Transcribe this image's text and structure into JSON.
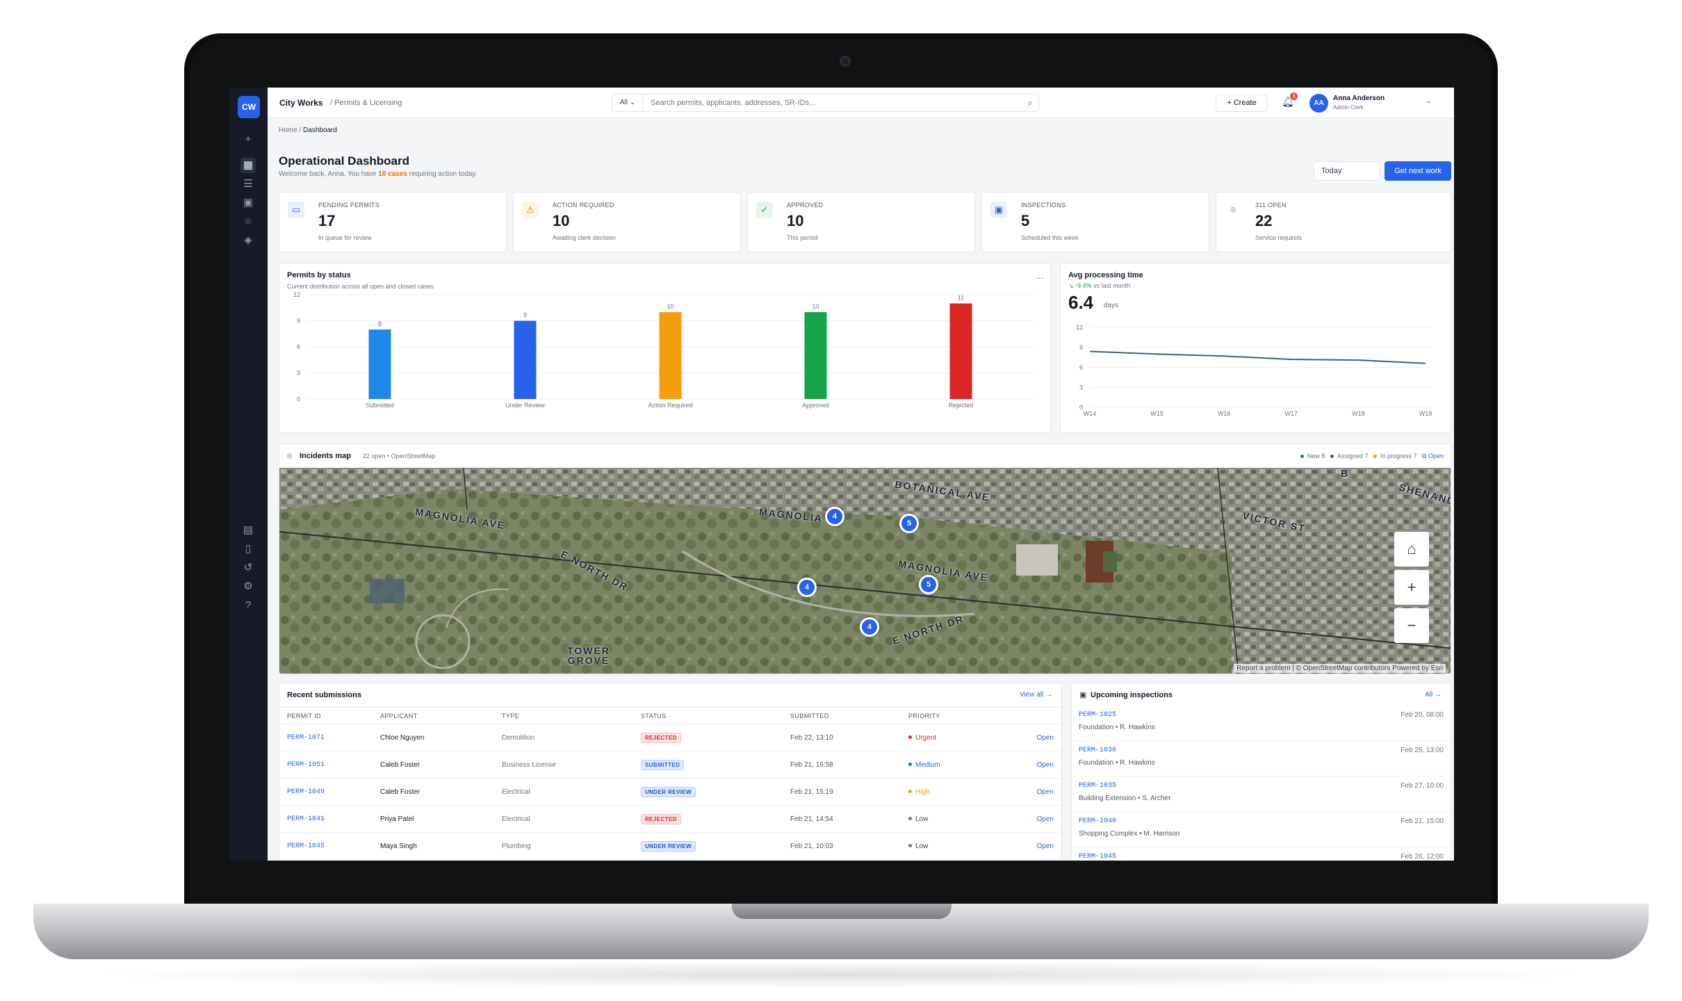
{
  "app": {
    "logo": "CW",
    "name": "City Works",
    "section": "/ Permits & Licensing"
  },
  "rail": {
    "icons": [
      "plus-icon",
      "dashboard-icon",
      "tasks-icon",
      "calendar-icon",
      "map-pin-icon",
      "shield-icon",
      "book-icon",
      "document-icon",
      "history-icon",
      "settings-icon",
      "help-icon"
    ]
  },
  "search": {
    "scope": "All",
    "placeholder": "Search permits, applicants, addresses, SR-IDs..."
  },
  "topbar": {
    "create_label": "Create",
    "notif_count": "3",
    "user_initials": "AA",
    "user_name": "Anna Anderson",
    "user_role": "Admin Clerk"
  },
  "breadcrumb": {
    "home": "Home",
    "current": "Dashboard"
  },
  "page": {
    "title": "Operational Dashboard",
    "subtitle_pre": "Welcome back, Anna. You have ",
    "subtitle_hl": "10 cases",
    "subtitle_post": " requiring action today.",
    "date_filter": "Today",
    "next_work_label": "Get next work"
  },
  "kpis": [
    {
      "label": "PENDING PERMITS",
      "value": "17",
      "sub": "In queue for review",
      "icon": "inbox-icon"
    },
    {
      "label": "ACTION REQUIRED",
      "value": "10",
      "sub": "Awaiting clerk decision",
      "icon": "warning-icon"
    },
    {
      "label": "APPROVED",
      "value": "10",
      "sub": "This period",
      "icon": "check-circle-icon"
    },
    {
      "label": "INSPECTIONS",
      "value": "5",
      "sub": "Scheduled this week",
      "icon": "calendar-icon"
    },
    {
      "label": "311 OPEN",
      "value": "22",
      "sub": "Service requests",
      "icon": "map-pin-icon"
    }
  ],
  "permits_chart_card": {
    "title": "Permits by status",
    "subtitle": "Current distribution across all open and closed cases",
    "menu": "..."
  },
  "avg_card": {
    "title": "Avg processing time",
    "trend": "-9.4%",
    "trend_sub": "vs last month",
    "value": "6.4",
    "unit": "days"
  },
  "chart_data": [
    {
      "type": "bar",
      "categories": [
        "Submitted",
        "Under Review",
        "Action Required",
        "Approved",
        "Rejected"
      ],
      "values": [
        8,
        9,
        10,
        10,
        11
      ],
      "colors": [
        "#1e88e5",
        "#2563eb",
        "#f59e0b",
        "#16a34a",
        "#dc2626"
      ],
      "yticks": [
        "12",
        "9",
        "6",
        "3",
        "0"
      ],
      "ylim": [
        0,
        12
      ]
    },
    {
      "type": "line",
      "x": [
        "W14",
        "W15",
        "W16",
        "W17",
        "W18",
        "W19"
      ],
      "values": [
        8.4,
        8.0,
        7.7,
        7.2,
        7.1,
        6.6
      ],
      "color": "#3b5f8f",
      "yticks": [
        "12",
        "9",
        "6",
        "3",
        "0"
      ],
      "ylim": [
        0,
        12
      ]
    }
  ],
  "map": {
    "title": "Incidents map",
    "meta": "22 open • OpenStreetMap",
    "legend": [
      {
        "label": "New 8",
        "color": "#2563eb"
      },
      {
        "label": "Assigned 7",
        "color": "#3b5f8f"
      },
      {
        "label": "In progress 7",
        "color": "#f59e0b"
      }
    ],
    "open_label": "Open",
    "clusters": [
      "4",
      "5",
      "4",
      "5",
      "4"
    ],
    "streets": [
      "MAGNOLIA AVE",
      "MAGNOLIA",
      "BOTANICAL AVE",
      "MAGNOLIA AVE",
      "E NORTH DR",
      "E NORTH DR",
      "TOWER GROVE",
      "VICTOR ST",
      "SHENAND",
      "B"
    ],
    "attribution": "Report a problem | © OpenStreetMap contributors   Powered by Esri"
  },
  "recent": {
    "title": "Recent submissions",
    "view_all": "View all →",
    "headers": [
      "PERMIT ID",
      "APPLICANT",
      "TYPE",
      "STATUS",
      "SUBMITTED",
      "PRIORITY"
    ],
    "rows": [
      {
        "id": "PERM-1071",
        "applicant": "Chloe Nguyen",
        "type": "Demolition",
        "status": "REJECTED",
        "submitted": "Feb 22, 13:10",
        "priority": "Urgent",
        "action": "Open"
      },
      {
        "id": "PERM-1051",
        "applicant": "Caleb Foster",
        "type": "Business License",
        "status": "SUBMITTED",
        "submitted": "Feb 21, 16:58",
        "priority": "Medium",
        "action": "Open"
      },
      {
        "id": "PERM-1049",
        "applicant": "Caleb Foster",
        "type": "Electrical",
        "status": "UNDER REVIEW",
        "submitted": "Feb 21, 15:19",
        "priority": "High",
        "action": "Open"
      },
      {
        "id": "PERM-1041",
        "applicant": "Priya Patel",
        "type": "Electrical",
        "status": "REJECTED",
        "submitted": "Feb 21, 14:54",
        "priority": "Low",
        "action": "Open"
      },
      {
        "id": "PERM-1045",
        "applicant": "Maya Singh",
        "type": "Plumbing",
        "status": "UNDER REVIEW",
        "submitted": "Feb 21, 10:03",
        "priority": "Low",
        "action": "Open"
      }
    ],
    "status_colors": {
      "REJECTED": [
        "#fee2e2",
        "#dc2626"
      ],
      "SUBMITTED": [
        "#dbeafe",
        "#2563eb"
      ],
      "UNDER REVIEW": [
        "#dbeafe",
        "#1d4ed8"
      ]
    },
    "priority_colors": {
      "Urgent": "#dc2626",
      "Medium": "#2563eb",
      "High": "#f59e0b",
      "Low": "#6b7280"
    }
  },
  "inspections": {
    "title": "Upcoming inspections",
    "all_label": "All →",
    "items": [
      {
        "id": "PERM-1025",
        "desc": "Foundation • R. Hawkins",
        "time": "Feb 20, 08:00"
      },
      {
        "id": "PERM-1030",
        "desc": "Foundation • R. Hawkins",
        "time": "Feb 25, 13:00"
      },
      {
        "id": "PERM-1035",
        "desc": "Building Extension • S. Archer",
        "time": "Feb 27, 10:00"
      },
      {
        "id": "PERM-1040",
        "desc": "Shopping Complex • M. Harrison",
        "time": "Feb 21, 15:00"
      },
      {
        "id": "PERM-1045",
        "desc": "",
        "time": "Feb 26, 12:00"
      }
    ]
  }
}
